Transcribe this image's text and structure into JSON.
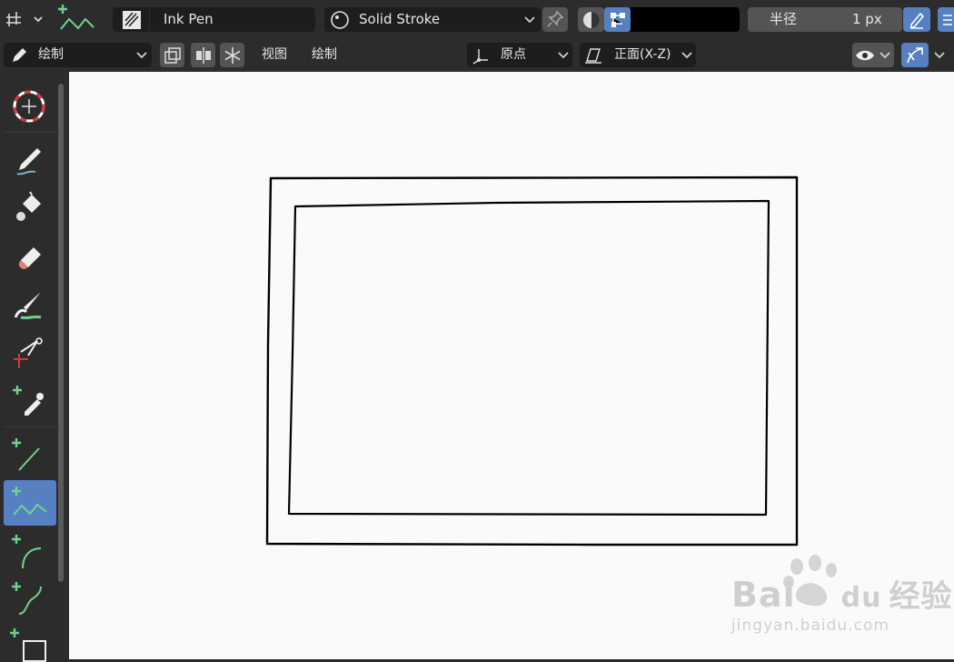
{
  "header": {
    "brush_name": "Ink Pen",
    "material_name": "Solid Stroke",
    "radius_label": "半径",
    "radius_value": "1 px"
  },
  "subheader": {
    "mode": "绘制",
    "menu_view": "视图",
    "menu_draw": "绘制",
    "origin": "原点",
    "orientation": "正面(X-Z)"
  },
  "colors": {
    "accent": "#5680c2",
    "canvas": "#fafafa",
    "stroke": "#000000",
    "tool_green": "#6fd38d"
  },
  "toolbar": {
    "active_tool": "polyline-tool"
  },
  "watermark": {
    "brand_a": "Bai",
    "brand_b": "du",
    "brand_c": "经验",
    "url": "jingyan.baidu.com"
  }
}
